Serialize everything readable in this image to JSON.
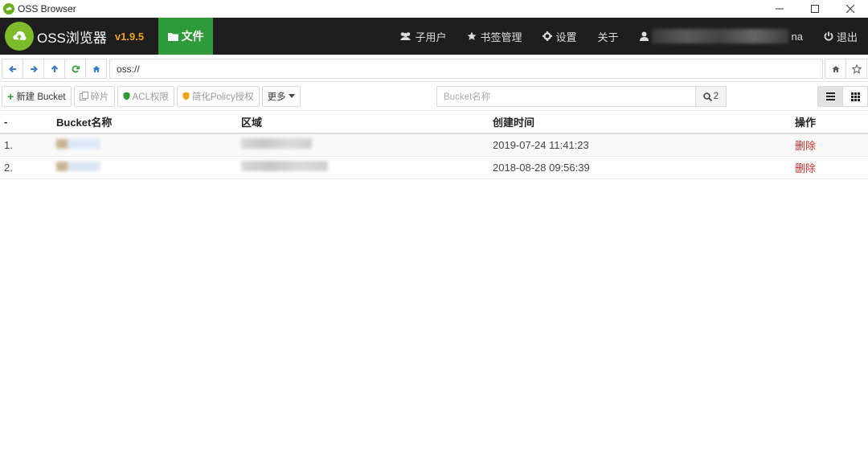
{
  "window": {
    "title": "OSS Browser",
    "controls": {
      "minimize": "—",
      "maximize": "☐",
      "close": "✕"
    }
  },
  "nav": {
    "brand_name": "OSS浏览器",
    "version": "v1.9.5",
    "files_label": "文件",
    "items": {
      "subusers": "子用户",
      "bookmarks": "书签管理",
      "settings": "设置",
      "about": "关于",
      "user_suffix": "na",
      "logout": "退出"
    }
  },
  "address": {
    "path": "oss://"
  },
  "toolbar": {
    "new_bucket": "新建 Bucket",
    "fragments": "碎片",
    "acl": "ACL权限",
    "policy": "简化Policy授权",
    "more": "更多",
    "search_placeholder": "Bucket名称",
    "search_count": "2"
  },
  "table": {
    "headers": {
      "index": "",
      "name": "Bucket名称",
      "region": "区域",
      "created": "创建时间",
      "action": "操作"
    },
    "rows": [
      {
        "index": "1.",
        "created": "2019-07-24 11:41:23",
        "action": "删除"
      },
      {
        "index": "2.",
        "created": "2018-08-28 09:56:39",
        "action": "删除"
      }
    ]
  },
  "colors": {
    "nav_bg": "#1e1e1e",
    "accent_green": "#2f9a3a",
    "version_orange": "#f0a21b",
    "danger": "#c9302c"
  },
  "icons": [
    "back-icon",
    "forward-icon",
    "up-icon",
    "refresh-icon",
    "home-icon",
    "star-icon",
    "folder-icon",
    "users-icon",
    "star-icon",
    "gear-icon",
    "user-icon",
    "power-icon",
    "search-icon",
    "list-view-icon",
    "grid-view-icon"
  ]
}
